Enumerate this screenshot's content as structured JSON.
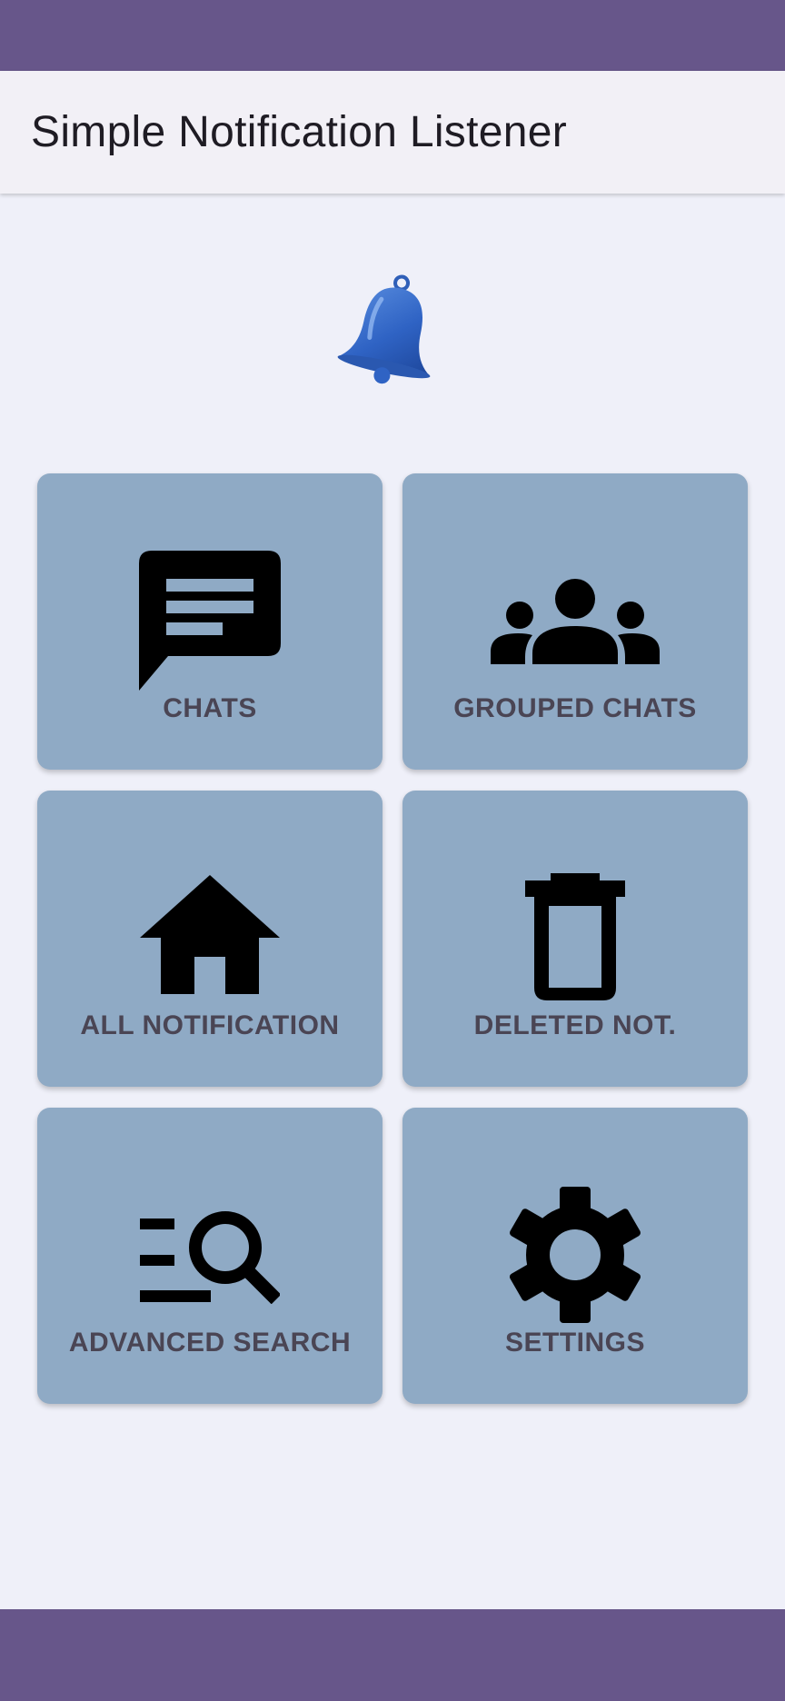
{
  "app": {
    "title": "Simple Notification Listener",
    "status_bar_color": "#67568a",
    "tile_color": "#8faac5",
    "label_color": "#4a4554"
  },
  "logo": {
    "icon": "bell-icon"
  },
  "tiles": [
    {
      "label": "CHATS",
      "icon": "chat-icon"
    },
    {
      "label": "GROUPED CHATS",
      "icon": "groups-icon"
    },
    {
      "label": "ALL NOTIFICATION",
      "icon": "home-icon"
    },
    {
      "label": "DELETED NOT.",
      "icon": "trash-icon"
    },
    {
      "label": "ADVANCED SEARCH",
      "icon": "manage-search-icon"
    },
    {
      "label": "SETTINGS",
      "icon": "gear-icon"
    }
  ]
}
